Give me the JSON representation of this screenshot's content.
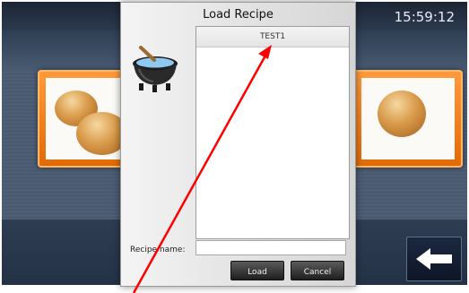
{
  "header": {
    "time": "15:59:12"
  },
  "dialog": {
    "title": "Load Recipe",
    "recipes": [
      "TEST1"
    ],
    "recipe_name_label": "Recipe name:",
    "recipe_name_value": "",
    "load_label": "Load",
    "cancel_label": "Cancel"
  },
  "icons": {
    "recipe": "cooking-pot-icon",
    "back": "left-arrow-icon"
  },
  "colors": {
    "annotation": "#ff0000",
    "tile_orange": "#f07d12",
    "background": "#3d4f66"
  }
}
